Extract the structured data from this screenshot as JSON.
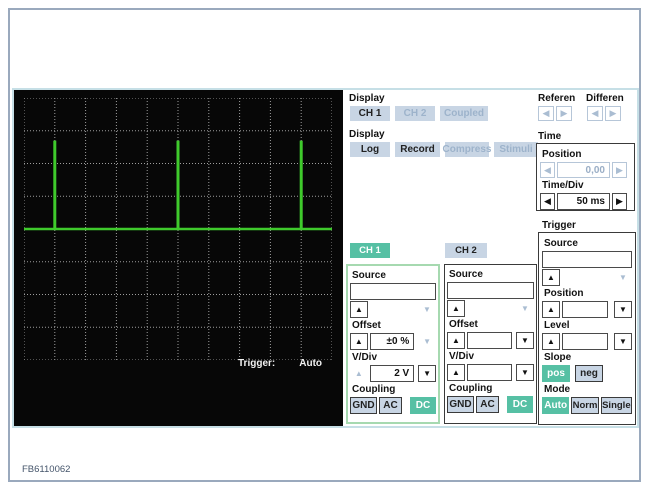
{
  "window": {
    "figure_label": "FB6110062"
  },
  "icons": {
    "arrow_up": "▲",
    "arrow_down": "▼",
    "arrow_left": "◀",
    "arrow_right": "▶"
  },
  "colors": {
    "accent_teal": "#56c0a4",
    "button_gray": "#c8d5e4",
    "scope_green": "#3fca2c",
    "frame_border": "#9aa9bd",
    "panel_border": "#c6dfe6",
    "ch1_border": "#a6d9b0"
  },
  "scope": {
    "trigger_status_label": "Trigger:",
    "trigger_status_value": "Auto",
    "grid_cols": 10,
    "grid_rows": 8,
    "waveform": {
      "type": "pulse-train",
      "baseline_div": 4,
      "spike_top_div": 1.3,
      "spike_positions_div": [
        1,
        5,
        9
      ],
      "period_divs": 4,
      "time_per_div": "50 ms"
    }
  },
  "display_channel_group": {
    "label": "Display",
    "buttons": [
      {
        "label": "CH 1",
        "state": "active"
      },
      {
        "label": "CH 2",
        "state": "disabled"
      },
      {
        "label": "Coupled",
        "state": "disabled"
      }
    ]
  },
  "display_mode_group": {
    "label": "Display",
    "buttons": [
      {
        "label": "Log",
        "state": "active"
      },
      {
        "label": "Record",
        "state": "active"
      },
      {
        "label": "Compress",
        "state": "disabled"
      },
      {
        "label": "Stimuli",
        "state": "disabled"
      }
    ]
  },
  "reference_group": {
    "label": "Referen"
  },
  "difference_group": {
    "label": "Differen"
  },
  "time_group": {
    "label": "Time",
    "position_label": "Position",
    "position_value": "0,00",
    "time_div_label": "Time/Div",
    "time_div_value": "50 ms"
  },
  "trigger_group": {
    "label": "Trigger",
    "source_label": "Source",
    "source_value": "",
    "position_label": "Position",
    "position_value": "",
    "level_label": "Level",
    "level_value": "",
    "slope_label": "Slope",
    "slope_pos": "pos",
    "slope_neg": "neg",
    "mode_label": "Mode",
    "mode_auto": "Auto",
    "mode_norm": "Norm",
    "mode_single": "Single"
  },
  "channel1": {
    "tab_label": "CH 1",
    "source_label": "Source",
    "source_value": "",
    "offset_label": "Offset",
    "offset_value": "±0 %",
    "vdiv_label": "V/Div",
    "vdiv_value": "2 V",
    "coupling_label": "Coupling",
    "coupling_gnd": "GND",
    "coupling_ac": "AC",
    "coupling_dc": "DC"
  },
  "channel2": {
    "tab_label": "CH 2",
    "source_label": "Source",
    "source_value": "",
    "offset_label": "Offset",
    "offset_value": "",
    "vdiv_label": "V/Div",
    "vdiv_value": "",
    "coupling_label": "Coupling",
    "coupling_gnd": "GND",
    "coupling_ac": "AC",
    "coupling_dc": "DC"
  }
}
